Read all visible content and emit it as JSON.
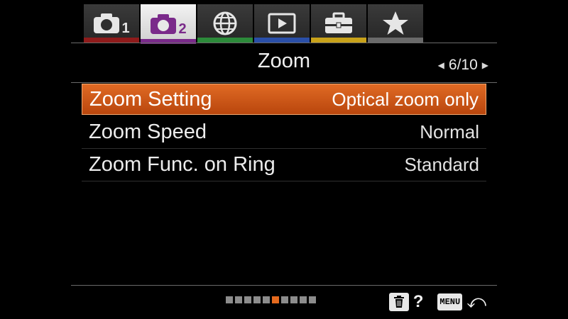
{
  "tabs": [
    {
      "icon": "camera-icon",
      "sub": "1",
      "color": "#8f1b1b",
      "active": false
    },
    {
      "icon": "camera-icon",
      "sub": "2",
      "color": "#7a2a8a",
      "active": true
    },
    {
      "icon": "globe-icon",
      "sub": "",
      "color": "#2c8a3a",
      "active": false
    },
    {
      "icon": "playback-icon",
      "sub": "",
      "color": "#2a4fa8",
      "active": false
    },
    {
      "icon": "toolbox-icon",
      "sub": "",
      "color": "#c8a21a",
      "active": false
    },
    {
      "icon": "star-icon",
      "sub": "",
      "color": "#6a6a6a",
      "active": false
    }
  ],
  "header": {
    "title": "Zoom",
    "page": "6/10"
  },
  "menu": {
    "items": [
      {
        "label": "Zoom Setting",
        "value": "Optical zoom only",
        "selected": true
      },
      {
        "label": "Zoom Speed",
        "value": "Normal",
        "selected": false
      },
      {
        "label": "Zoom Func. on Ring",
        "value": "Standard",
        "selected": false
      }
    ]
  },
  "pager": {
    "total": 10,
    "current": 6
  },
  "footer": {
    "help": "?",
    "menu_key": "MENU",
    "back_icon": "back-arrow-icon",
    "delete_icon": "trash-icon"
  },
  "colors": {
    "accent": "#e06a24",
    "background": "#000000"
  }
}
